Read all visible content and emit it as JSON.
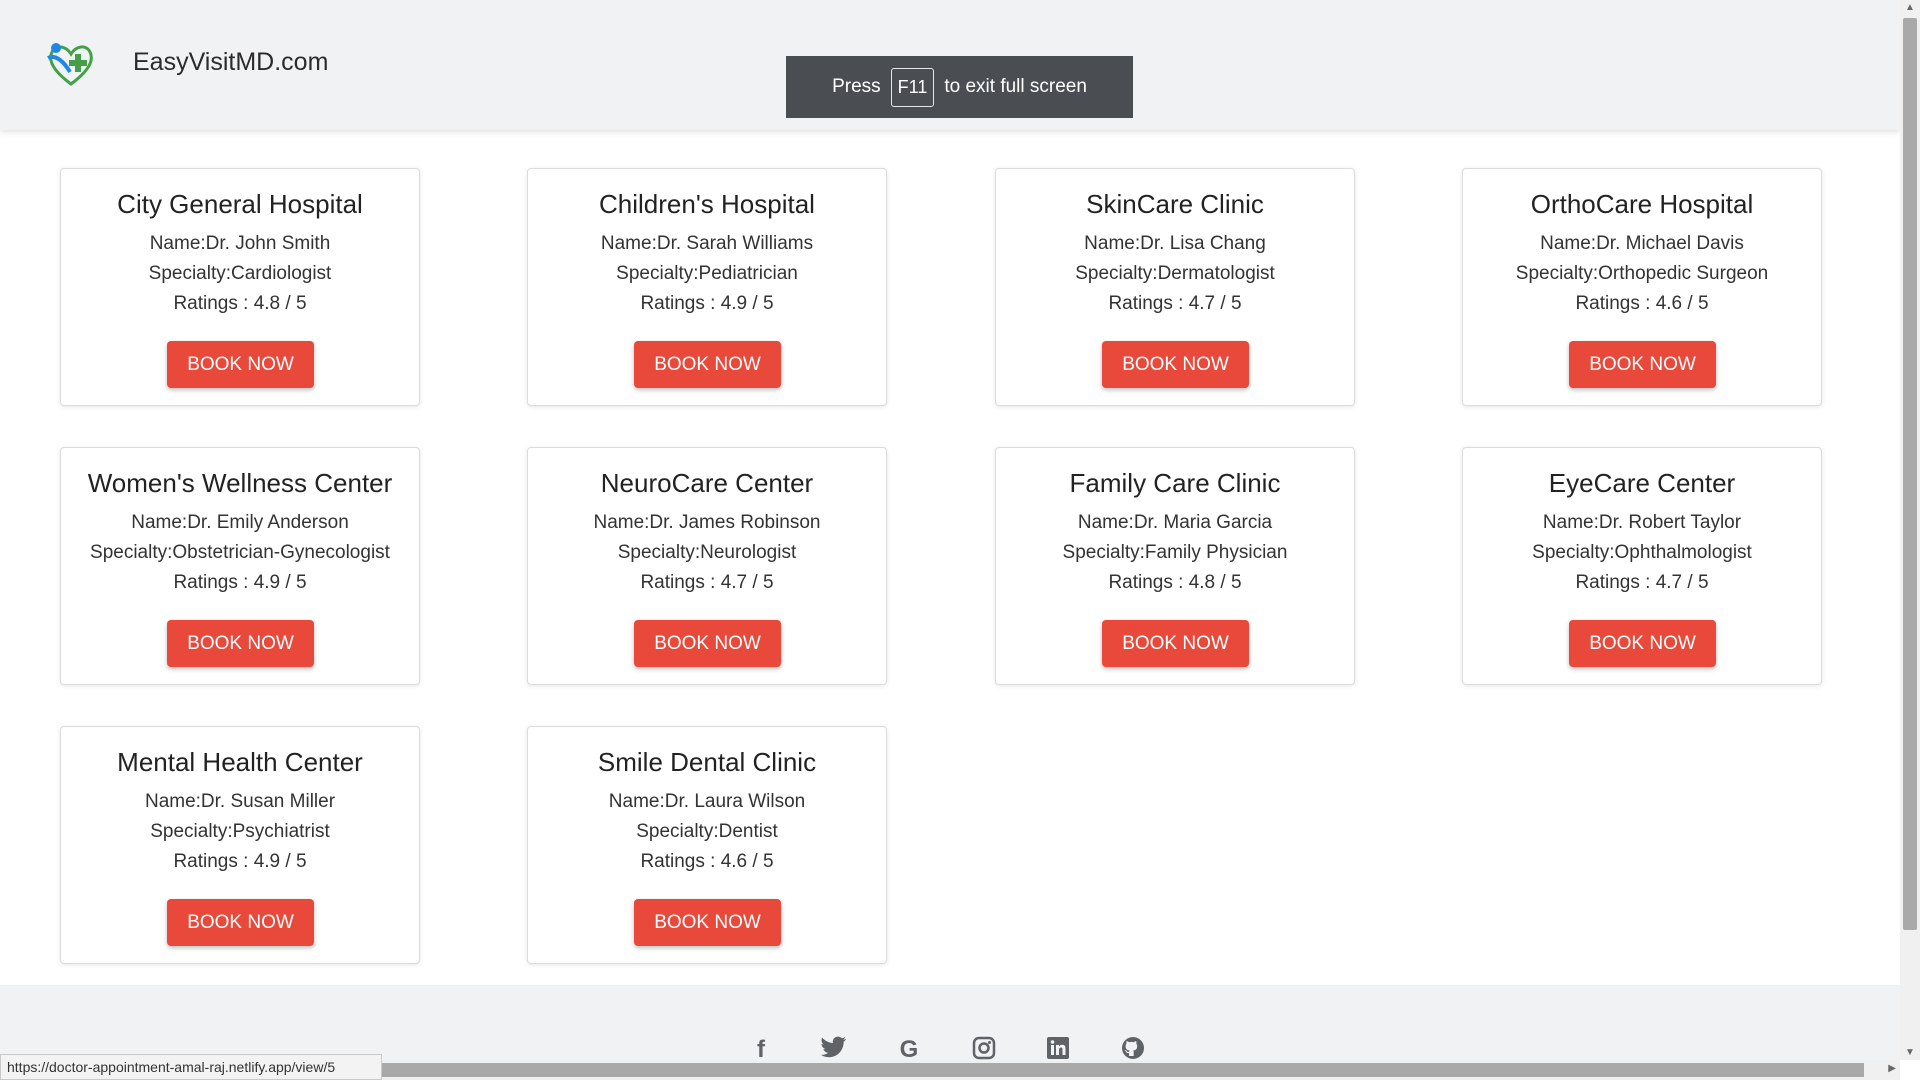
{
  "header": {
    "brand": "EasyVisitMD.com"
  },
  "fullscreen_notice": {
    "press": "Press",
    "key": "F11",
    "rest": "to exit full screen"
  },
  "book_label": "BOOK NOW",
  "cards": [
    {
      "hospital": "City General Hospital",
      "name": "Name:Dr. John Smith",
      "specialty": "Specialty:Cardiologist",
      "rating": "Ratings : 4.8 / 5"
    },
    {
      "hospital": "Children's Hospital",
      "name": "Name:Dr. Sarah Williams",
      "specialty": "Specialty:Pediatrician",
      "rating": "Ratings : 4.9 / 5"
    },
    {
      "hospital": "SkinCare Clinic",
      "name": "Name:Dr. Lisa Chang",
      "specialty": "Specialty:Dermatologist",
      "rating": "Ratings : 4.7 / 5"
    },
    {
      "hospital": "OrthoCare Hospital",
      "name": "Name:Dr. Michael Davis",
      "specialty": "Specialty:Orthopedic Surgeon",
      "rating": "Ratings : 4.6 / 5"
    },
    {
      "hospital": "Women's Wellness Center",
      "name": "Name:Dr. Emily Anderson",
      "specialty": "Specialty:Obstetrician-Gynecologist",
      "rating": "Ratings : 4.9 / 5"
    },
    {
      "hospital": "NeuroCare Center",
      "name": "Name:Dr. James Robinson",
      "specialty": "Specialty:Neurologist",
      "rating": "Ratings : 4.7 / 5"
    },
    {
      "hospital": "Family Care Clinic",
      "name": "Name:Dr. Maria Garcia",
      "specialty": "Specialty:Family Physician",
      "rating": "Ratings : 4.8 / 5"
    },
    {
      "hospital": "EyeCare Center",
      "name": "Name:Dr. Robert Taylor",
      "specialty": "Specialty:Ophthalmologist",
      "rating": "Ratings : 4.7 / 5"
    },
    {
      "hospital": "Mental Health Center",
      "name": "Name:Dr. Susan Miller",
      "specialty": "Specialty:Psychiatrist",
      "rating": "Ratings : 4.9 / 5"
    },
    {
      "hospital": "Smile Dental Clinic",
      "name": "Name:Dr. Laura Wilson",
      "specialty": "Specialty:Dentist",
      "rating": "Ratings : 4.6 / 5"
    }
  ],
  "footer": {
    "social_icons": [
      "facebook-icon",
      "twitter-icon",
      "google-icon",
      "instagram-icon",
      "linkedin-icon",
      "github-icon"
    ]
  },
  "status_url": "https://doctor-appointment-amal-raj.netlify.app/view/5",
  "colors": {
    "accent": "#e8493a",
    "navbar": "#f1f2f3",
    "logo_blue": "#1e88e5",
    "logo_green": "#43a047"
  }
}
